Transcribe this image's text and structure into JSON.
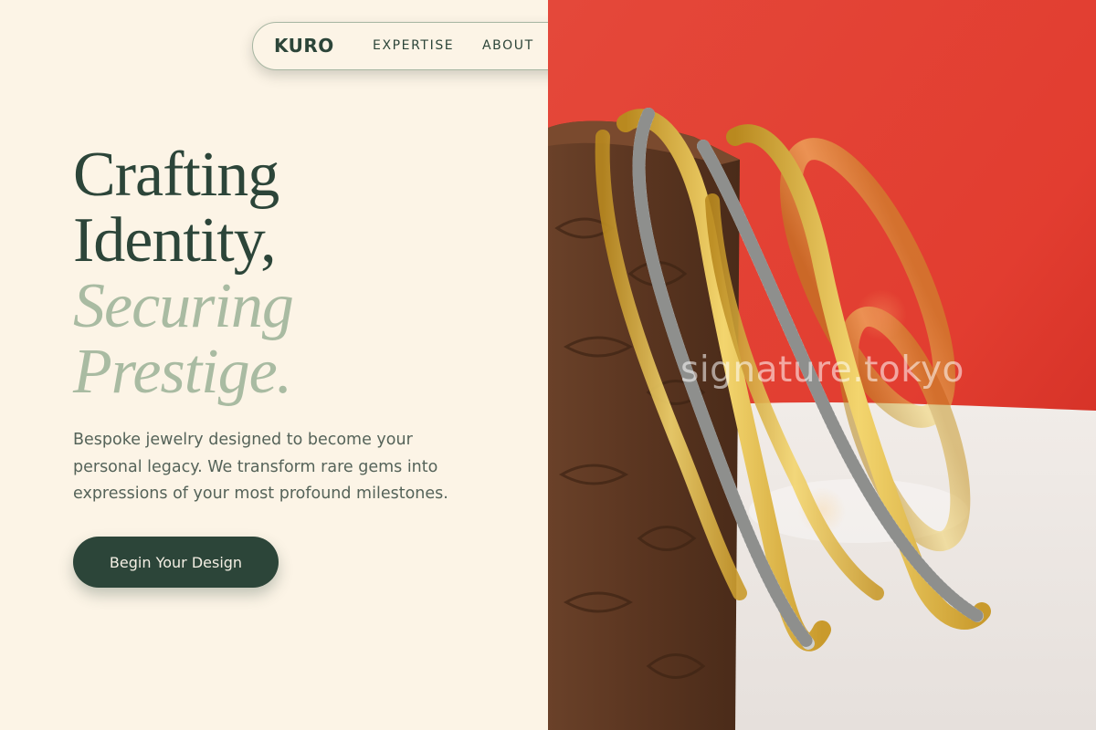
{
  "nav": {
    "logo": "KURO",
    "links": [
      "EXPERTISE",
      "ABOUT"
    ]
  },
  "hero": {
    "title_lines": [
      "Crafting",
      "Identity,"
    ],
    "accent_lines": [
      "Securing",
      "Prestige."
    ],
    "description": "Bespoke jewelry designed to become your personal legacy. We transform rare gems into expressions of your most profound milestones.",
    "cta_label": "Begin Your Design"
  },
  "image": {
    "subject": "gold and silver twisted bangles leaning on a carved wooden box against a red cloth",
    "watermark": "signature.tokyo"
  },
  "colors": {
    "background": "#fcf4e6",
    "primary": "#2c4539",
    "accent": "#a9bba2",
    "body_text": "#556359",
    "nav_border": "#a7b6a2"
  }
}
